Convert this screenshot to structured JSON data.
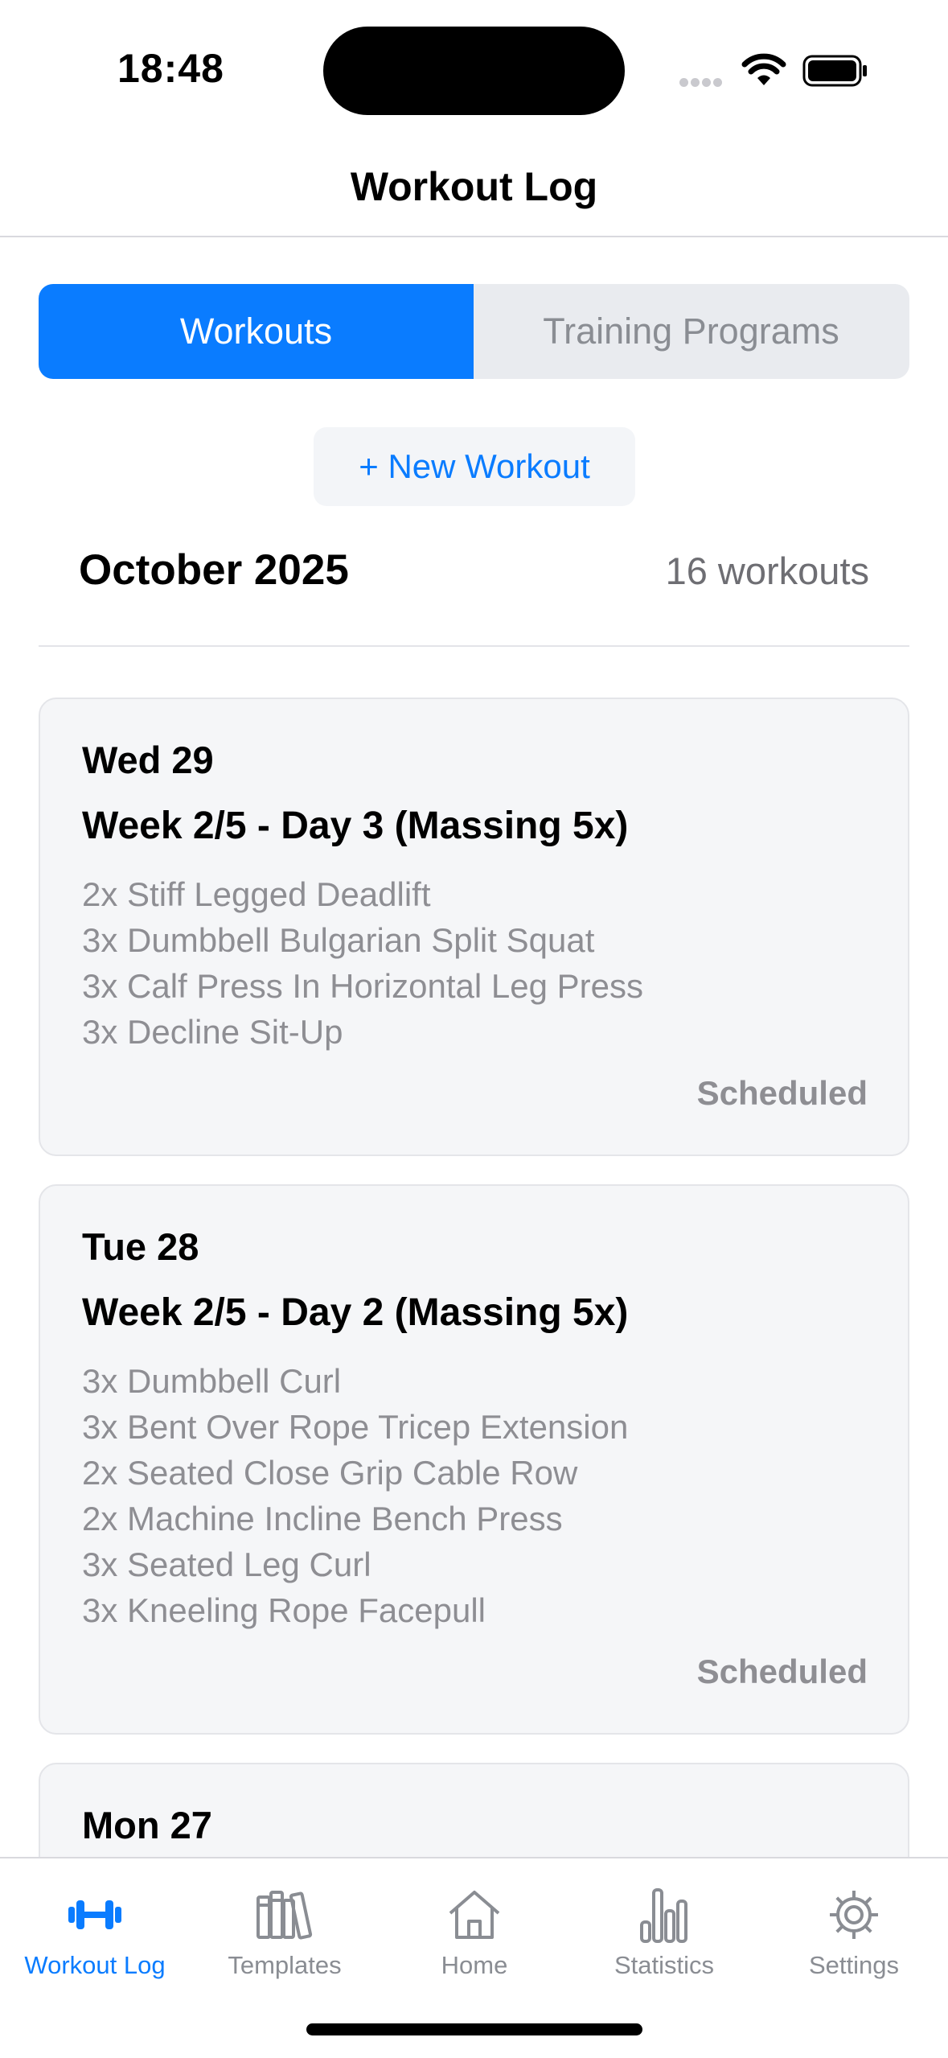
{
  "status_bar": {
    "time": "18:48"
  },
  "nav": {
    "title": "Workout Log"
  },
  "segments": {
    "left": "Workouts",
    "right": "Training Programs",
    "selected": "Workouts"
  },
  "new_workout_label": "+ New Workout",
  "month": {
    "name": "October 2025",
    "count": "16 workouts"
  },
  "workouts": [
    {
      "date": "Wed 29",
      "title": "Week 2/5 - Day 3 (Massing 5x)",
      "exercises": [
        "2x Stiff Legged Deadlift",
        "3x Dumbbell Bulgarian Split Squat",
        "3x Calf Press In Horizontal Leg Press",
        "3x Decline Sit-Up"
      ],
      "status": "Scheduled"
    },
    {
      "date": "Tue 28",
      "title": "Week 2/5 - Day 2 (Massing 5x)",
      "exercises": [
        "3x Dumbbell Curl",
        "3x Bent Over Rope Tricep Extension",
        "2x Seated Close Grip Cable Row",
        "2x Machine Incline Bench Press",
        "3x Seated Leg Curl",
        "3x Kneeling Rope Facepull"
      ],
      "status": "Scheduled"
    },
    {
      "date": "Mon 27"
    }
  ],
  "tabs": [
    {
      "label": "Workout Log",
      "icon": "dumbbell-icon",
      "active": true
    },
    {
      "label": "Templates",
      "icon": "books-icon",
      "active": false
    },
    {
      "label": "Home",
      "icon": "house-icon",
      "active": false
    },
    {
      "label": "Statistics",
      "icon": "bar-chart-icon",
      "active": false
    },
    {
      "label": "Settings",
      "icon": "gear-icon",
      "active": false
    }
  ],
  "colors": {
    "accent": "#0a7cff",
    "secondary_text": "#8e8e93",
    "card_bg": "#f5f6f8"
  }
}
